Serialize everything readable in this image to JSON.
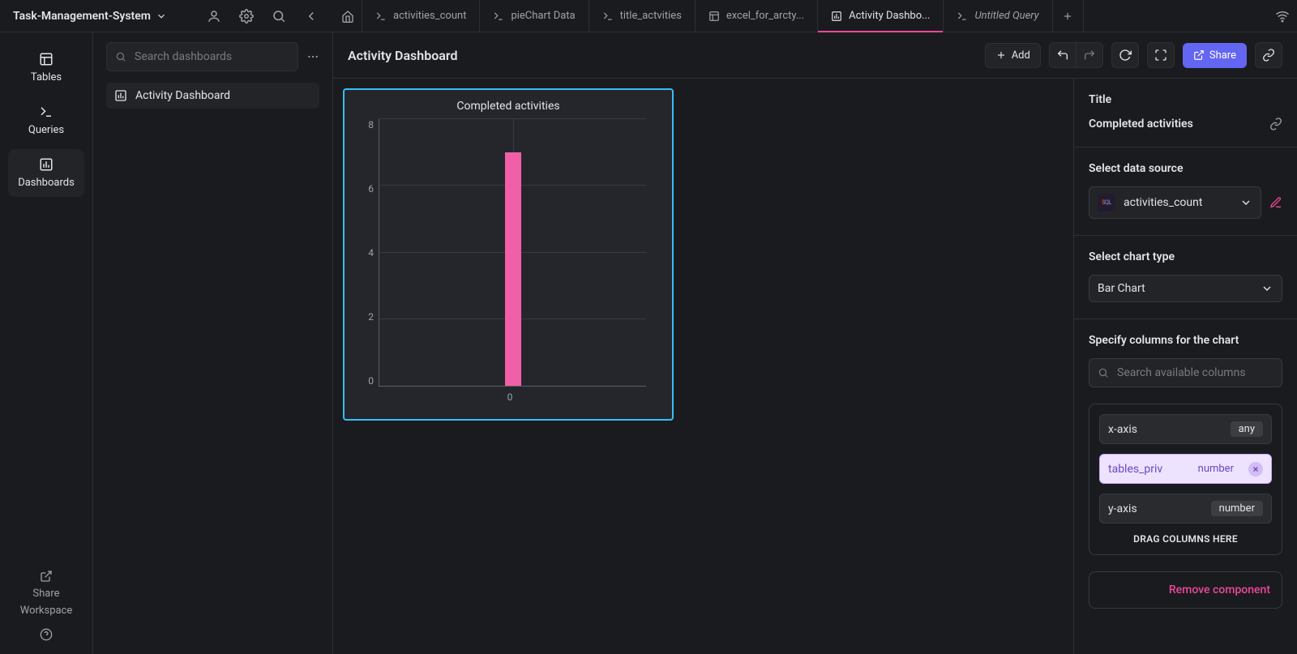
{
  "workspace": {
    "name": "Task-Management-System"
  },
  "navrail": {
    "tables": "Tables",
    "queries": "Queries",
    "dashboards": "Dashboards",
    "share_top": "Share",
    "share_bottom": "Workspace"
  },
  "listpanel": {
    "search_placeholder": "Search dashboards",
    "item_label": "Activity Dashboard"
  },
  "tabs": {
    "t0": "activities_count",
    "t1": "pieChart Data",
    "t2": "title_actvities",
    "t3": "excel_for_arcty...",
    "t4": "Activity Dashbo...",
    "t5": "Untitled Query"
  },
  "main": {
    "title": "Activity Dashboard",
    "add": "Add",
    "share": "Share"
  },
  "widget": {
    "title": "Completed activities"
  },
  "inspector": {
    "title_label": "Title",
    "title_value": "Completed activities",
    "ds_label": "Select data source",
    "ds_value": "activities_count",
    "chart_label": "Select chart type",
    "chart_value": "Bar Chart",
    "cols_label": "Specify columns for the chart",
    "cols_placeholder": "Search available columns",
    "x_label": "x-axis",
    "x_type": "any",
    "xcol_name": "tables_priv",
    "xcol_type": "number",
    "y_label": "y-axis",
    "y_type": "number",
    "drag_hint": "DRAG COLUMNS HERE",
    "remove": "Remove component"
  },
  "chart_data": {
    "type": "bar",
    "title": "Completed activities",
    "categories": [
      "0"
    ],
    "values": [
      7
    ],
    "xlabel": "",
    "ylabel": "",
    "ylim": [
      0,
      8
    ],
    "y_ticks": [
      0,
      2,
      4,
      6,
      8
    ]
  }
}
